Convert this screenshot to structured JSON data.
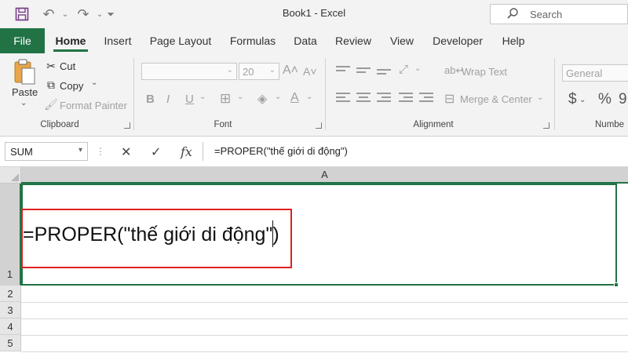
{
  "window": {
    "title": "Book1  -  Excel"
  },
  "search": {
    "placeholder": "Search"
  },
  "tabs": [
    "File",
    "Home",
    "Insert",
    "Page Layout",
    "Formulas",
    "Data",
    "Review",
    "View",
    "Developer",
    "Help"
  ],
  "active_tab": "Home",
  "ribbon": {
    "clipboard": {
      "label": "Clipboard",
      "paste": "Paste",
      "cut": "Cut",
      "copy": "Copy",
      "format_painter": "Format Painter"
    },
    "font": {
      "label": "Font",
      "size": "20"
    },
    "alignment": {
      "label": "Alignment",
      "wrap_text": "Wrap Text",
      "merge_center": "Merge & Center"
    },
    "number": {
      "label": "Numbe",
      "format": "General"
    }
  },
  "formula_bar": {
    "name_box": "SUM",
    "formula": "=PROPER(\"thế giới di động\")"
  },
  "grid": {
    "columns": [
      "A"
    ],
    "rows": [
      "1",
      "2",
      "3",
      "4",
      "5"
    ],
    "cell_A1": "=PROPER(\"thế giới di động\")"
  },
  "colors": {
    "accent": "#217346",
    "highlight": "#e02020"
  }
}
